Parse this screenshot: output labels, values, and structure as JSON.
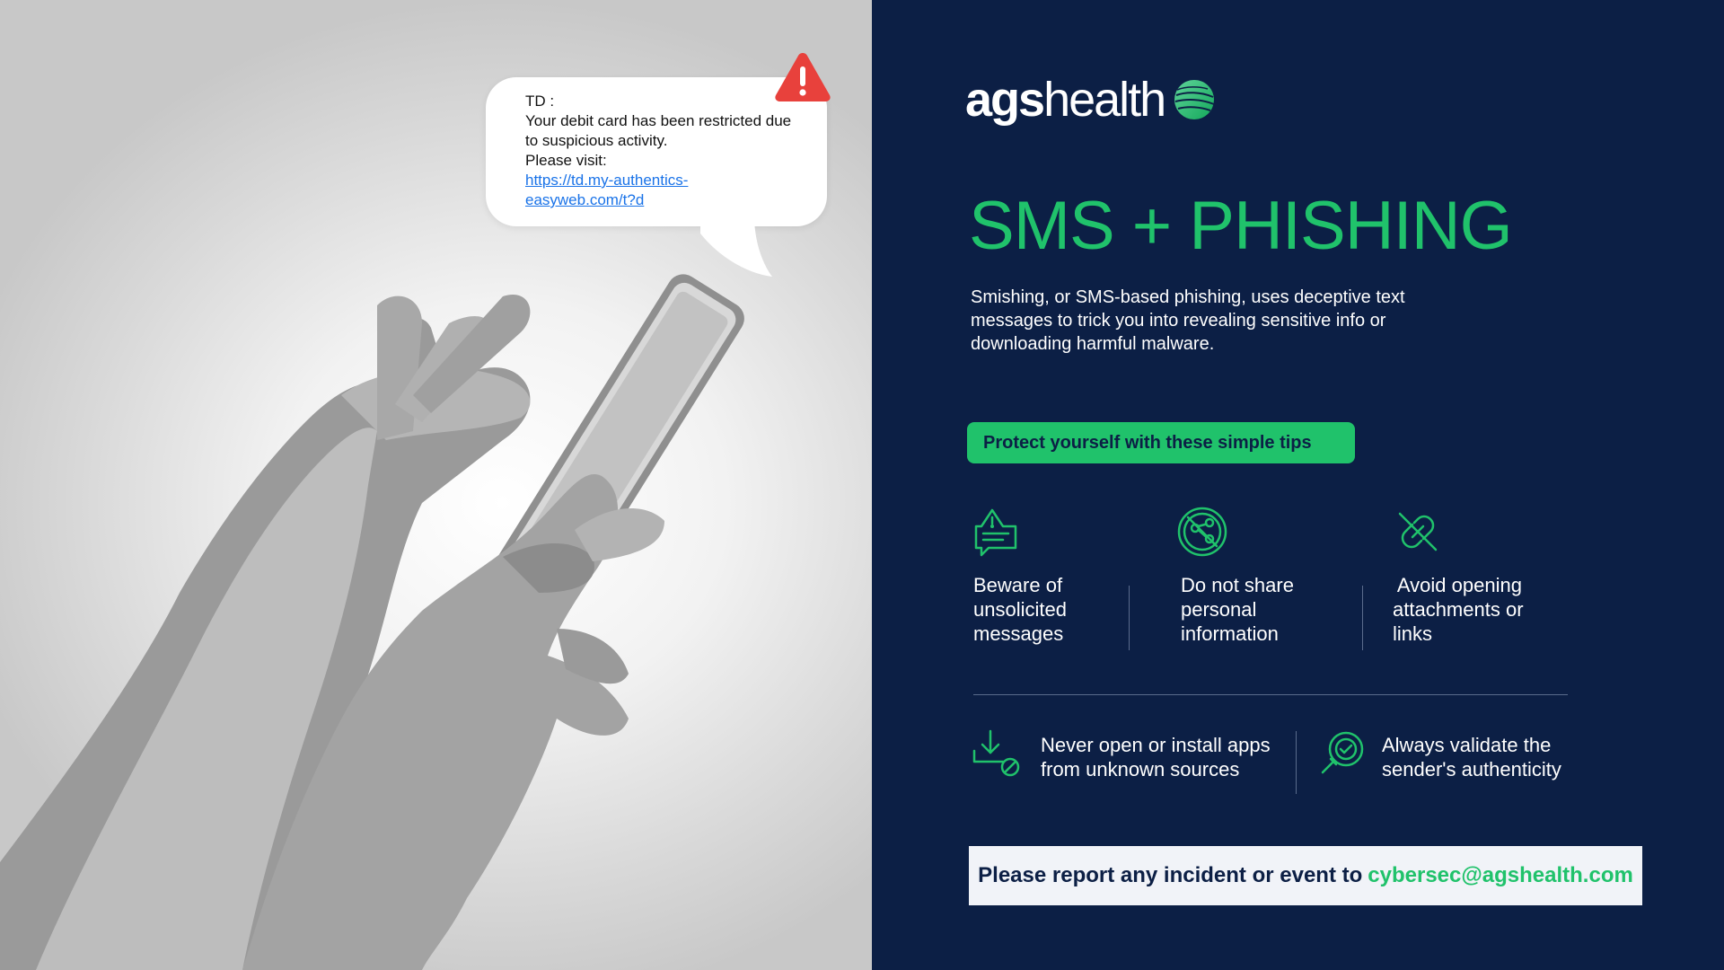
{
  "sms_bubble": {
    "sender": "TD :",
    "line1": "Your debit card has been restricted due",
    "line2": "to suspicious activity.",
    "line3": "Please visit:",
    "link_line1": "https://td.my-authentics-",
    "link_line2": "easyweb.com/t?d"
  },
  "brand": {
    "logo_bold": "ags",
    "logo_regular": "health"
  },
  "title": "SMS + PHISHING",
  "intro": {
    "line1": "Smishing, or SMS-based phishing, uses deceptive text",
    "line2": "messages to trick you into revealing sensitive info or",
    "line3": "downloading harmful malware."
  },
  "tips_heading": "Protect yourself with these simple tips",
  "tips": [
    {
      "icon": "warning-message-icon",
      "line1": "Beware of",
      "line2": "unsolicited",
      "line3": "messages"
    },
    {
      "icon": "no-share-icon",
      "line1": "Do not share",
      "line2": "personal",
      "line3": "information"
    },
    {
      "icon": "broken-link-icon",
      "line1": " Avoid opening",
      "line2": "attachments or",
      "line3": "links"
    },
    {
      "icon": "blocked-download-icon",
      "line1": "Never open or install apps",
      "line2": "from unknown sources"
    },
    {
      "icon": "verify-search-icon",
      "line1": "Always validate the",
      "line2": "sender's authenticity"
    }
  ],
  "report": {
    "text": "Please report any incident or event to",
    "email": "cybersec@agshealth.com"
  },
  "colors": {
    "navy": "#0c1f45",
    "green": "#20c26b",
    "alert_red": "#e8413c",
    "link_blue": "#1a73e8"
  }
}
